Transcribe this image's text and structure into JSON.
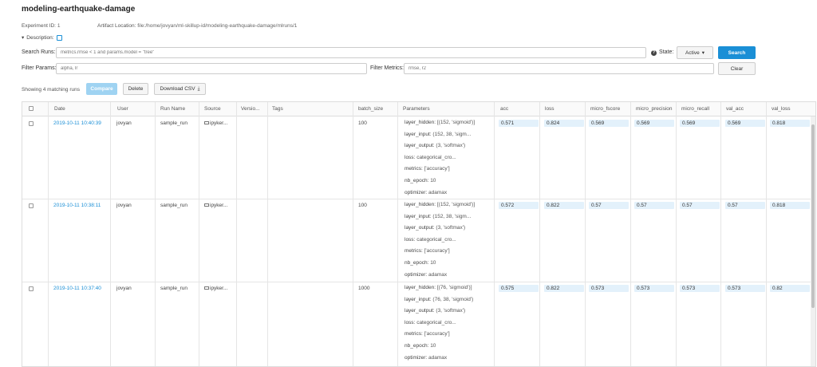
{
  "experiment": {
    "title": "modeling-earthquake-damage",
    "id_label": "Experiment ID:",
    "id_value": "1",
    "artifact_label": "Artifact Location:",
    "artifact_value": "file:/home/jovyan/ml-skillup-id/modeling-earthquake-damage/mlruns/1",
    "description_label": "Description:"
  },
  "search": {
    "runs_label": "Search Runs:",
    "runs_placeholder": "metrics.rmse < 1 and params.model = \"tree\"",
    "state_label": "State:",
    "state_value": "Active",
    "search_button": "Search",
    "params_label": "Filter Params:",
    "params_placeholder": "alpha, lr",
    "metrics_label": "Filter Metrics:",
    "metrics_placeholder": "rmse, r2",
    "clear_button": "Clear"
  },
  "toolbar": {
    "showing_text": "Showing 4 matching runs",
    "compare_button": "Compare",
    "delete_button": "Delete",
    "download_button": "Download CSV"
  },
  "columns": {
    "date": "Date",
    "user": "User",
    "run_name": "Run Name",
    "source": "Source",
    "version": "Versio...",
    "tags": "Tags",
    "batch_size": "batch_size",
    "parameters": "Parameters",
    "acc": "acc",
    "loss": "loss",
    "micro_fscore": "micro_fscore",
    "micro_precision": "micro_precision",
    "micro_recall": "micro_recall",
    "val_acc": "val_acc",
    "val_loss": "val_loss"
  },
  "param_keys": [
    "layer_hidden:",
    "layer_input:",
    "layer_output:",
    "loss:",
    "metrics:",
    "nb_epoch:",
    "optimizer:"
  ],
  "runs": [
    {
      "date": "2019-10-11 10:40:39",
      "user": "jovyan",
      "run_name": "sample_run",
      "source": "ipyker...",
      "batch_size": "100",
      "params": [
        "[(152, 'sigmoid')]",
        "(152, 38, 'sigm...",
        "(3, 'softmax')",
        "categorical_cro...",
        "['accuracy']",
        "10",
        "adamax"
      ],
      "acc": "0.571",
      "loss": "0.824",
      "micro_fscore": "0.569",
      "micro_precision": "0.569",
      "micro_recall": "0.569",
      "val_acc": "0.569",
      "val_loss": "0.818"
    },
    {
      "date": "2019-10-11 10:38:11",
      "user": "jovyan",
      "run_name": "sample_run",
      "source": "ipyker...",
      "batch_size": "100",
      "params": [
        "[(152, 'sigmoid')]",
        "(152, 38, 'sigm...",
        "(3, 'softmax')",
        "categorical_cro...",
        "['accuracy']",
        "10",
        "adamax"
      ],
      "acc": "0.572",
      "loss": "0.822",
      "micro_fscore": "0.57",
      "micro_precision": "0.57",
      "micro_recall": "0.57",
      "val_acc": "0.57",
      "val_loss": "0.818"
    },
    {
      "date": "2019-10-11 10:37:40",
      "user": "jovyan",
      "run_name": "sample_run",
      "source": "ipyker...",
      "batch_size": "1000",
      "params": [
        "[(76, 'sigmoid')]",
        "(76, 38, 'sigmoid')",
        "(3, 'softmax')",
        "categorical_cro...",
        "['accuracy']",
        "10",
        "adamax"
      ],
      "acc": "0.575",
      "loss": "0.822",
      "micro_fscore": "0.573",
      "micro_precision": "0.573",
      "micro_recall": "0.573",
      "val_acc": "0.573",
      "val_loss": "0.82"
    }
  ]
}
